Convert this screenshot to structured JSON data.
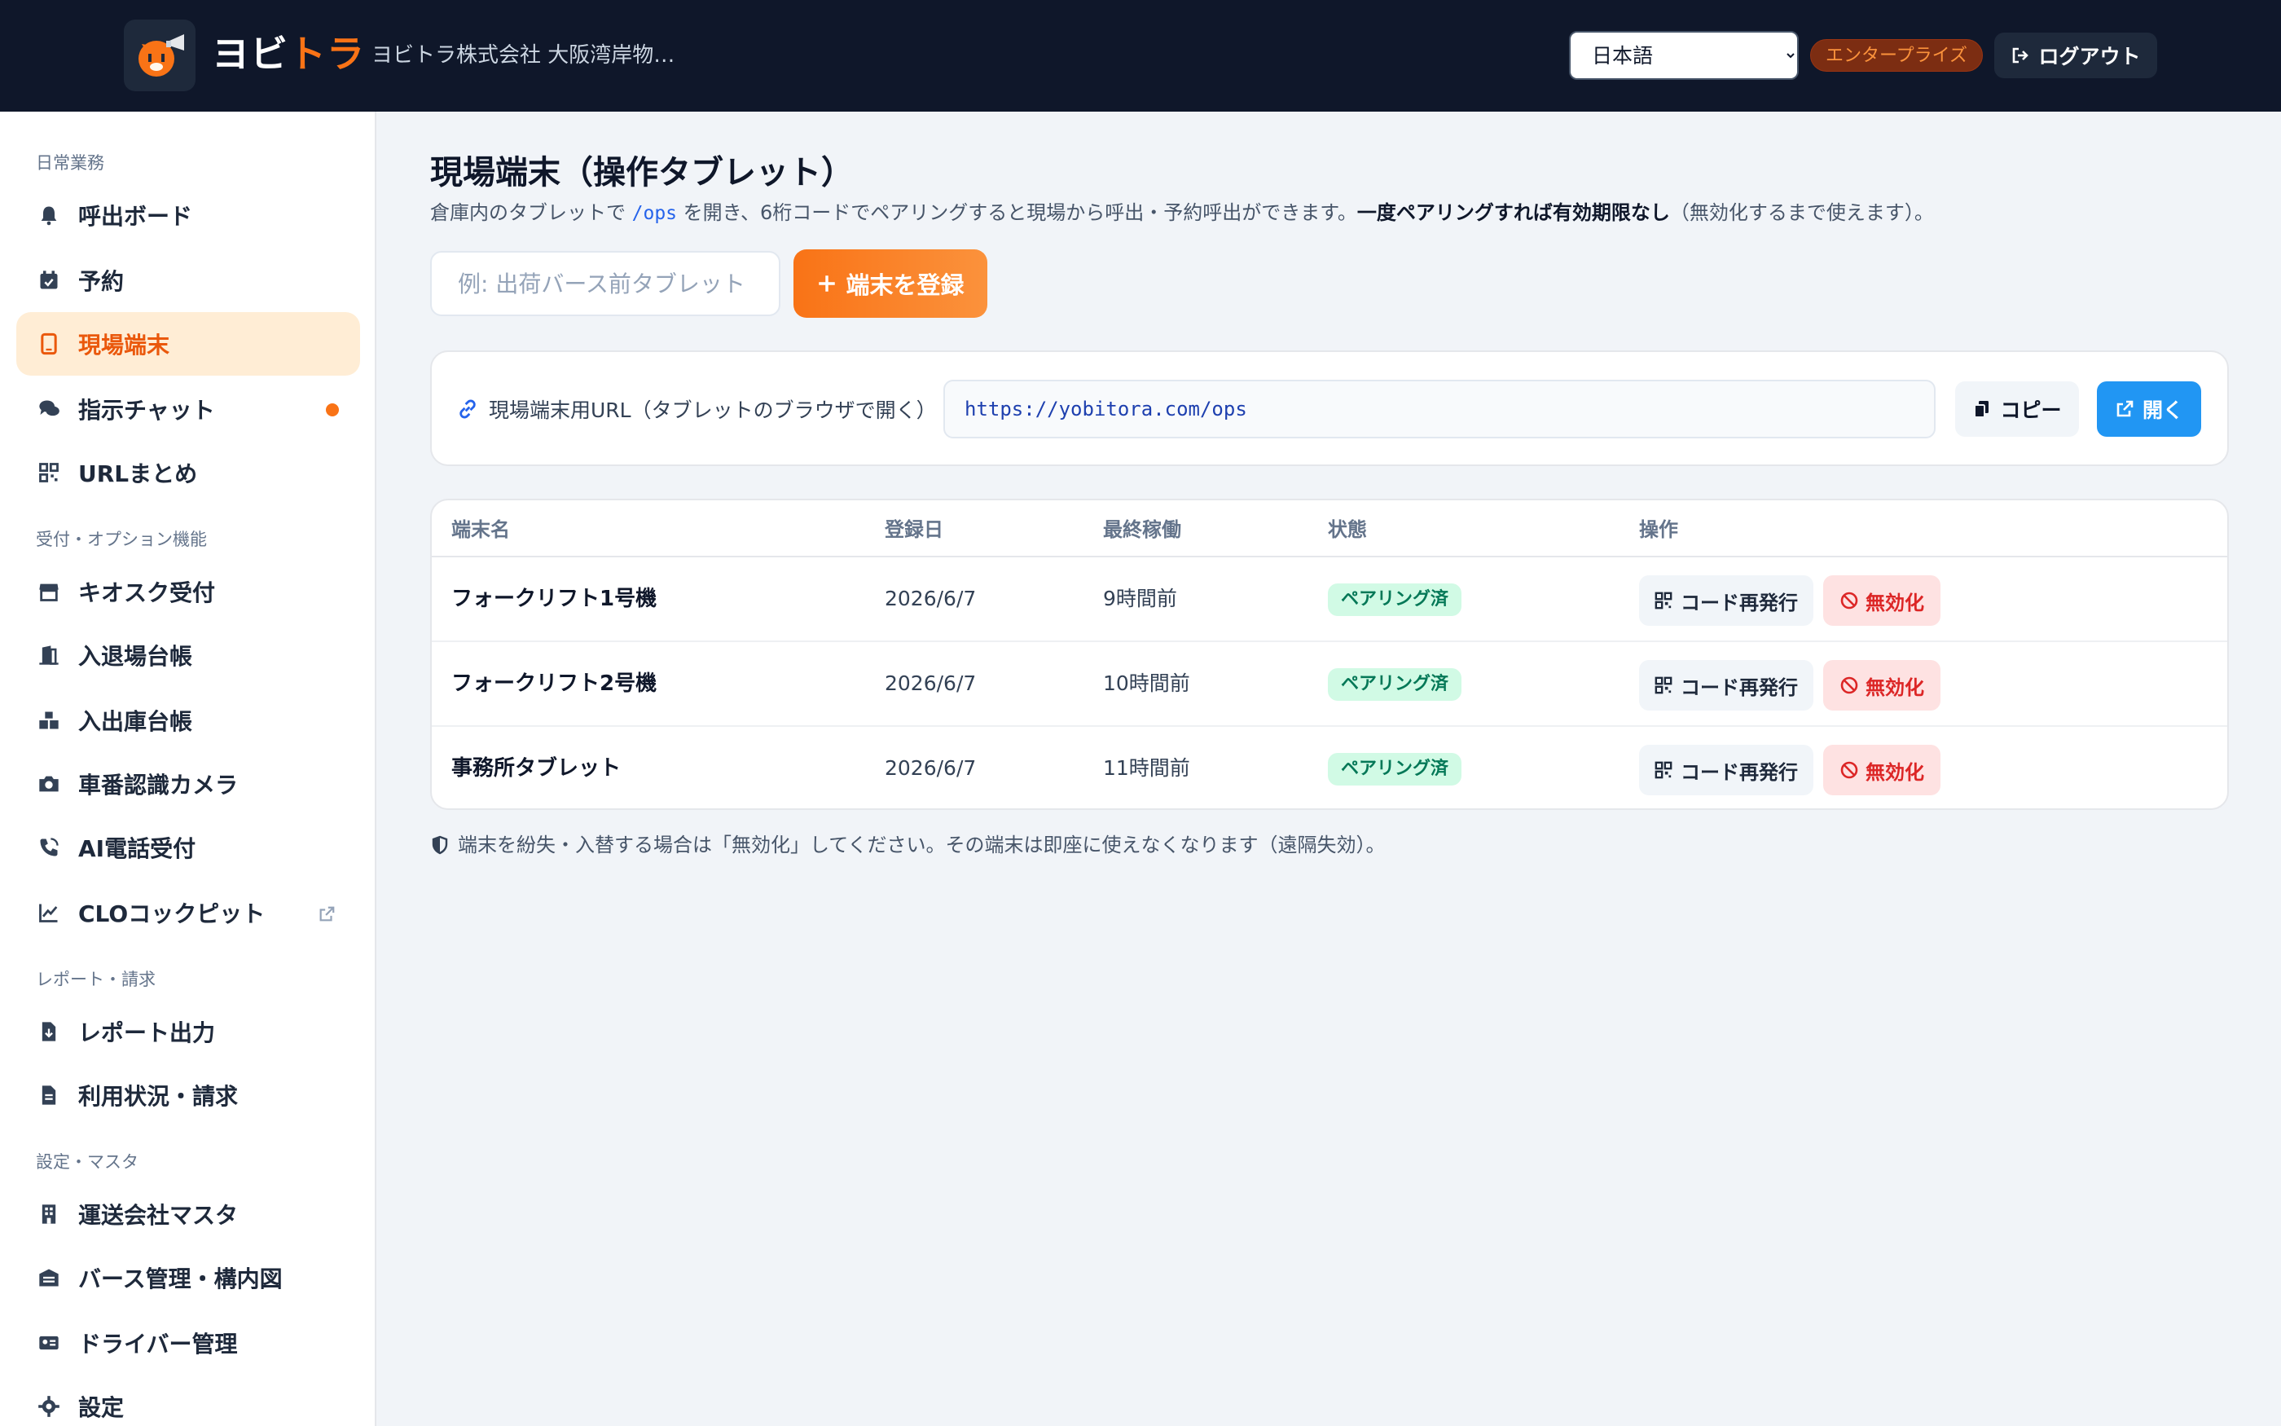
{
  "header": {
    "brand_part1": "ヨビ",
    "brand_part2": "トラ",
    "company": "ヨビトラ株式会社 大阪湾岸物…",
    "language_selected": "日本語",
    "plan_badge": "エンタープライズ",
    "logout_label": "ログアウト"
  },
  "sidebar": {
    "sections": [
      {
        "label": "日常業務"
      },
      {
        "label": "受付・オプション機能"
      },
      {
        "label": "レポート・請求"
      },
      {
        "label": "設定・マスタ"
      }
    ],
    "items": [
      {
        "label": "呼出ボード",
        "icon": "bell-icon"
      },
      {
        "label": "予約",
        "icon": "calendar-check-icon"
      },
      {
        "label": "現場端末",
        "icon": "tablet-icon",
        "active": true
      },
      {
        "label": "指示チャット",
        "icon": "chat-icon",
        "unread": true
      },
      {
        "label": "URLまとめ",
        "icon": "qr-grid-icon"
      },
      {
        "label": "キオスク受付",
        "icon": "store-icon"
      },
      {
        "label": "入退場台帳",
        "icon": "door-icon"
      },
      {
        "label": "入出庫台帳",
        "icon": "boxes-icon"
      },
      {
        "label": "車番認識カメラ",
        "icon": "camera-icon"
      },
      {
        "label": "AI電話受付",
        "icon": "phone-volume-icon"
      },
      {
        "label": "CLOコックピット",
        "icon": "chart-line-icon",
        "external": true
      },
      {
        "label": "レポート出力",
        "icon": "file-download-icon"
      },
      {
        "label": "利用状況・請求",
        "icon": "file-invoice-icon"
      },
      {
        "label": "運送会社マスタ",
        "icon": "building-icon"
      },
      {
        "label": "バース管理・構内図",
        "icon": "warehouse-icon"
      },
      {
        "label": "ドライバー管理",
        "icon": "id-card-icon"
      },
      {
        "label": "設定",
        "icon": "gear-icon"
      }
    ]
  },
  "main": {
    "title": "現場端末（操作タブレット）",
    "desc_pre": "倉庫内のタブレットで ",
    "desc_code": "/ops",
    "desc_mid": " を開き、6桁コードでペアリングすると現場から呼出・予約呼出ができます。",
    "desc_bold": "一度ペアリングすれば有効期限なし",
    "desc_post": "（無効化するまで使えます）。",
    "input_placeholder": "例: 出荷バース前タブレット",
    "register_label": "端末を登録",
    "url_label": "現場端末用URL（タブレットのブラウザで開く）",
    "url_value": "https://yobitora.com/ops",
    "copy_label": "コピー",
    "open_label": "開く",
    "table": {
      "headers": [
        "端末名",
        "登録日",
        "最終稼働",
        "状態",
        "操作"
      ],
      "rows": [
        {
          "name": "フォークリフト1号機",
          "registered": "2026/6/7",
          "last_active": "9時間前",
          "status": "ペアリング済"
        },
        {
          "name": "フォークリフト2号機",
          "registered": "2026/6/7",
          "last_active": "10時間前",
          "status": "ペアリング済"
        },
        {
          "name": "事務所タブレット",
          "registered": "2026/6/7",
          "last_active": "11時間前",
          "status": "ペアリング済"
        }
      ],
      "reissue_label": "コード再発行",
      "disable_label": "無効化"
    },
    "footnote": "端末を紛失・入替する場合は「無効化」してください。その端末は即座に使えなくなります（遠隔失効）。"
  },
  "colors": {
    "header_bg": "#0f172a",
    "accent": "#f97316",
    "primary_blue": "#2196f3",
    "success": "#047857",
    "danger": "#dc2626"
  }
}
